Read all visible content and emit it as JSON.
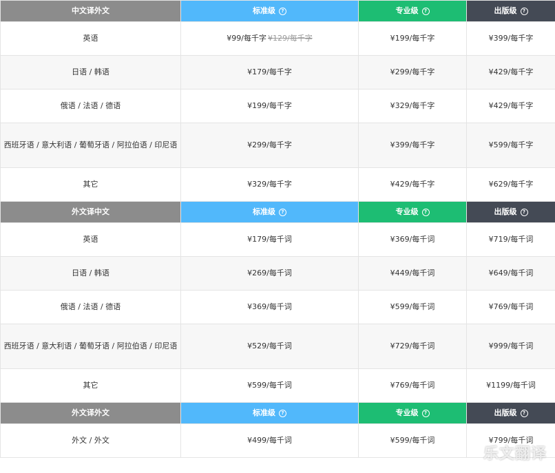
{
  "sections": [
    {
      "header": {
        "category": "中文译外文",
        "standard": "标准级",
        "professional": "专业级",
        "publishing": "出版级"
      },
      "rows": [
        {
          "lang": "英语",
          "standard": "¥99/每千字",
          "standard_old": "¥129/每千字",
          "professional": "¥199/每千字",
          "publishing": "¥399/每千字"
        },
        {
          "lang": "日语 / 韩语",
          "standard": "¥179/每千字",
          "professional": "¥299/每千字",
          "publishing": "¥429/每千字"
        },
        {
          "lang": "俄语 / 法语 / 德语",
          "standard": "¥199/每千字",
          "professional": "¥329/每千字",
          "publishing": "¥429/每千字"
        },
        {
          "lang": "西班牙语 / 意大利语 / 葡萄牙语 / 阿拉伯语 / 印尼语",
          "standard": "¥299/每千字",
          "professional": "¥399/每千字",
          "publishing": "¥599/每千字"
        },
        {
          "lang": "其它",
          "standard": "¥329/每千字",
          "professional": "¥429/每千字",
          "publishing": "¥629/每千字"
        }
      ]
    },
    {
      "header": {
        "category": "外文译中文",
        "standard": "标准级",
        "professional": "专业级",
        "publishing": "出版级"
      },
      "rows": [
        {
          "lang": "英语",
          "standard": "¥179/每千词",
          "professional": "¥369/每千词",
          "publishing": "¥719/每千词"
        },
        {
          "lang": "日语 / 韩语",
          "standard": "¥269/每千词",
          "professional": "¥449/每千词",
          "publishing": "¥649/每千词"
        },
        {
          "lang": "俄语 / 法语 / 德语",
          "standard": "¥369/每千词",
          "professional": "¥599/每千词",
          "publishing": "¥769/每千词"
        },
        {
          "lang": "西班牙语 / 意大利语 / 葡萄牙语 / 阿拉伯语 / 印尼语",
          "standard": "¥529/每千词",
          "professional": "¥729/每千词",
          "publishing": "¥999/每千词"
        },
        {
          "lang": "其它",
          "standard": "¥599/每千词",
          "professional": "¥769/每千词",
          "publishing": "¥1199/每千词"
        }
      ]
    },
    {
      "header": {
        "category": "外文译外文",
        "standard": "标准级",
        "professional": "专业级",
        "publishing": "出版级"
      },
      "rows": [
        {
          "lang": "外文 / 外文",
          "standard": "¥499/每千词",
          "professional": "¥599/每千词",
          "publishing": "¥799/每千词"
        }
      ]
    }
  ],
  "help_glyph": "?",
  "watermark": "乐文翻译",
  "colors": {
    "category": "#8c8c8c",
    "standard": "#51b8fb",
    "professional": "#1dbd73",
    "publishing": "#444a55"
  }
}
